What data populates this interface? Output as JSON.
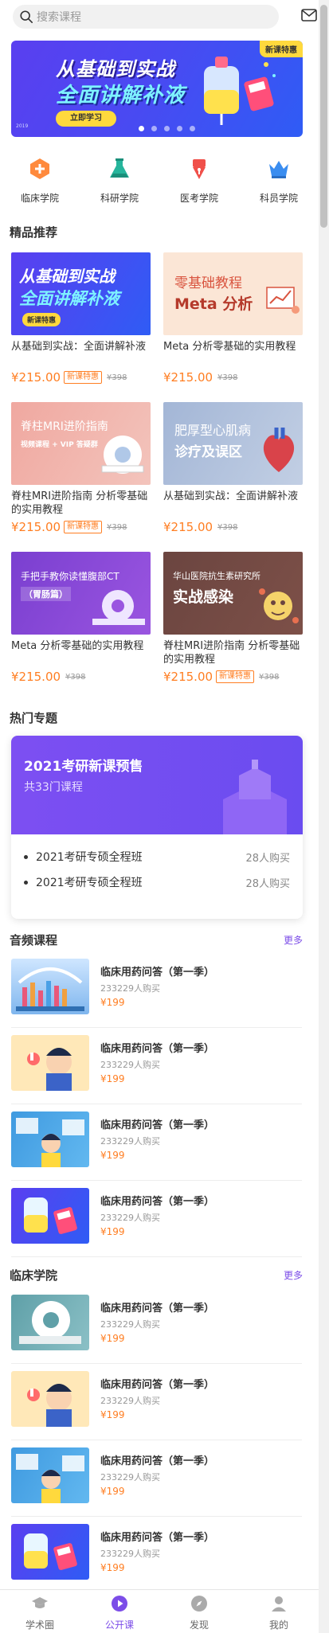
{
  "search": {
    "placeholder": "搜索课程"
  },
  "banner": {
    "line1": "从基础到实战",
    "line2": "全面讲解补液",
    "cta": "立即学习",
    "badge": "新课特惠",
    "year": "2019",
    "active_dot": 0,
    "dot_count": 5
  },
  "categories": [
    {
      "label": "临床学院",
      "icon": "plus-badge-icon",
      "color": "#ff8a3d"
    },
    {
      "label": "科研学院",
      "icon": "flask-icon",
      "color": "#26b59c"
    },
    {
      "label": "医考学院",
      "icon": "pen-icon",
      "color": "#f0504a"
    },
    {
      "label": "科员学院",
      "icon": "crown-icon",
      "color": "#3a8df0"
    }
  ],
  "featured": {
    "title": "精品推荐",
    "courses": [
      {
        "thumb_l1": "从基础到实战",
        "thumb_l2": "全面讲解补液",
        "thumb_badge": "新课特惠",
        "title": "从基础到实战：全面讲解补液",
        "price": "¥215.00",
        "tag": "新课特惠",
        "old": "¥398"
      },
      {
        "thumb_l1": "零基础教程",
        "thumb_l2": "Meta 分析",
        "title": "Meta 分析零基础的实用教程",
        "price": "¥215.00",
        "tag": "",
        "old": "¥398"
      },
      {
        "thumb_l1": "脊柱MRI进阶指南",
        "thumb_l2": "视频课程 + VIP 答疑群",
        "title": "脊柱MRI进阶指南 分析零基础的实用教程",
        "price": "¥215.00",
        "tag": "新课特惠",
        "old": "¥398"
      },
      {
        "thumb_l1": "肥厚型心肌病",
        "thumb_l2": "诊疗及误区",
        "title": "从基础到实战：全面讲解补液",
        "price": "¥215.00",
        "tag": "",
        "old": "¥398"
      },
      {
        "thumb_l1": "手把手教你读懂腹部CT",
        "thumb_l2": "（胃肠篇）",
        "title": "Meta 分析零基础的实用教程",
        "price": "¥215.00",
        "tag": "",
        "old": "¥398"
      },
      {
        "thumb_l1": "华山医院抗生素研究所",
        "thumb_l2": "实战感染",
        "title": "脊柱MRI进阶指南 分析零基础的实用教程",
        "price": "¥215.00",
        "tag": "新课特惠",
        "old": "¥398"
      }
    ]
  },
  "hot": {
    "title": "热门专题",
    "card_title": "2021考研新课预售",
    "card_sub": "共33门课程",
    "rows": [
      {
        "name": "2021考研专硕全程班",
        "count": "28人购买"
      },
      {
        "name": "2021考研专硕全程班",
        "count": "28人购买"
      }
    ]
  },
  "audio": {
    "title": "音频课程",
    "more": "更多",
    "items": [
      {
        "title": "临床用药问答（第一季）",
        "buyers": "233229人购买",
        "price": "¥199"
      },
      {
        "title": "临床用药问答（第一季）",
        "buyers": "233229人购买",
        "price": "¥199"
      },
      {
        "title": "临床用药问答（第一季）",
        "buyers": "233229人购买",
        "price": "¥199"
      },
      {
        "title": "临床用药问答（第一季）",
        "buyers": "233229人购买",
        "price": "¥199"
      }
    ]
  },
  "clinical": {
    "title": "临床学院",
    "more": "更多",
    "items": [
      {
        "title": "临床用药问答（第一季）",
        "buyers": "233229人购买",
        "price": "¥199"
      },
      {
        "title": "临床用药问答（第一季）",
        "buyers": "233229人购买",
        "price": "¥199"
      },
      {
        "title": "临床用药问答（第一季）",
        "buyers": "233229人购买",
        "price": "¥199"
      },
      {
        "title": "临床用药问答（第一季）",
        "buyers": "233229人购买",
        "price": "¥199"
      }
    ]
  },
  "tabs": [
    {
      "label": "学术圈",
      "icon": "graduation-cap-icon",
      "active": false
    },
    {
      "label": "公开课",
      "icon": "play-icon",
      "active": true
    },
    {
      "label": "发现",
      "icon": "compass-icon",
      "active": false
    },
    {
      "label": "我的",
      "icon": "user-icon",
      "active": false
    }
  ],
  "colors": {
    "accent": "#7c4de8",
    "price": "#ff7e22",
    "banner": "#4a49f2"
  }
}
